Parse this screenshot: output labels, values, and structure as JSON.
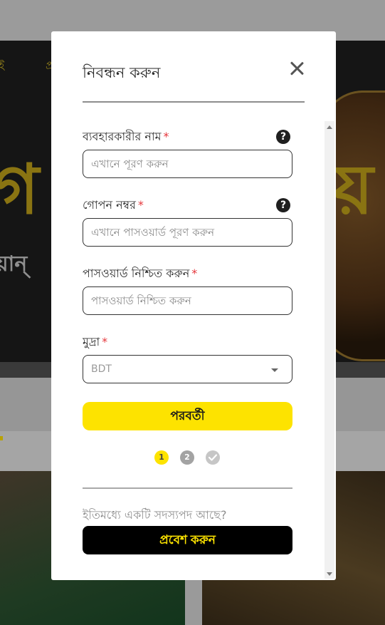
{
  "background": {
    "nav_fragment_1": "ই",
    "nav_fragment_2": "প্র",
    "hero_fragment": "গ",
    "hero_fragment_right": "য়",
    "hero_subtitle_fragment": "য়ান্"
  },
  "modal": {
    "title": "নিবন্ধন করুন",
    "fields": {
      "username": {
        "label": "ব্যবহারকারীর নাম",
        "required_mark": "*",
        "placeholder": "এখানে পূরণ করুন",
        "value": "",
        "help_icon": "question-circle-icon"
      },
      "password": {
        "label": "গোপন নম্বর",
        "required_mark": "*",
        "placeholder": "এখানে পাসওয়ার্ড পূরণ করুন",
        "value": "",
        "help_icon": "question-circle-icon"
      },
      "confirm_password": {
        "label": "পাসওয়ার্ড নিশ্চিত করুন",
        "required_mark": "*",
        "placeholder": "পাসওয়ার্ড নিশ্চিত করুন",
        "value": ""
      },
      "currency": {
        "label": "মুদ্রা",
        "required_mark": "*",
        "selected": "BDT"
      }
    },
    "next_button": "পরবর্তী",
    "steps": [
      {
        "label": "1",
        "state": "active"
      },
      {
        "label": "2",
        "state": "pending"
      },
      {
        "label": "",
        "state": "final",
        "icon": "check-icon"
      }
    ],
    "member_prompt": "ইতিমধ্যে একটি সদস্যপদ আছে?",
    "login_button": "প্রবেশ করুন"
  },
  "colors": {
    "accent_yellow": "#fde300",
    "required_red": "#e5363b",
    "dark": "#000000",
    "overlay_gray": "#9a9a9a"
  }
}
